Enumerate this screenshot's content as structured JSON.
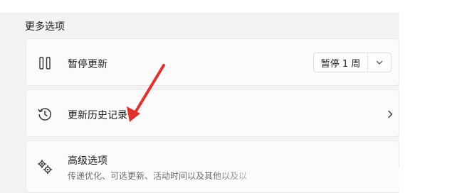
{
  "section": {
    "title": "更多选项"
  },
  "pause_updates": {
    "icon": "pause-icon",
    "label": "暂停更新",
    "dropdown_value": "暂停 1 周",
    "dropdown_icon": "chevron-down-icon"
  },
  "update_history": {
    "icon": "history-icon",
    "label": "更新历史记录",
    "chevron_icon": "chevron-right-icon"
  },
  "advanced_options": {
    "icon": "gears-icon",
    "label": "高级选项",
    "description": "传递优化、可选更新、活动时间以及其他以及以"
  },
  "annotation": {
    "arrow_color": "#e0312c"
  }
}
